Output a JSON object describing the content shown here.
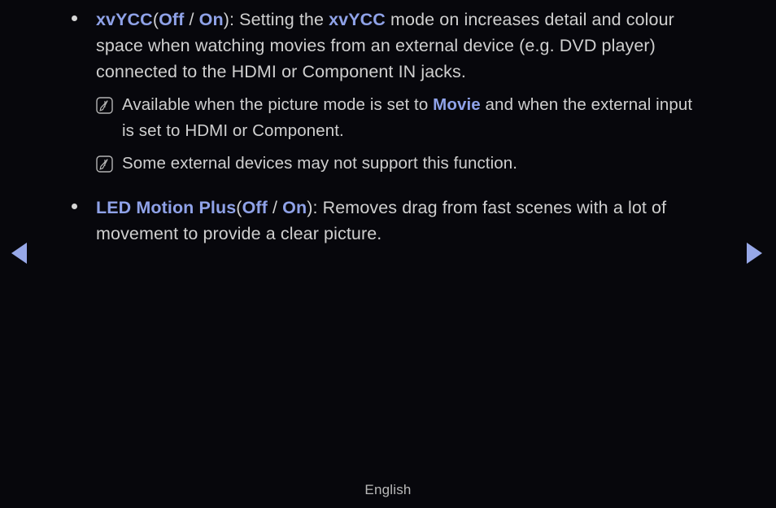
{
  "background_color": "#07070c",
  "accent_color": "#8fa2e8",
  "body_text_color": "#cfcfcf",
  "sections": [
    {
      "id": "xvycc",
      "bullet": "•",
      "title": "xvYCC",
      "options_open": "(",
      "option_off": "Off",
      "option_sep": " / ",
      "option_on": "On",
      "options_close": "): ",
      "body_part1": "Setting the ",
      "body_emphasis": "xvYCC",
      "body_part2": " mode on increases detail and colour space when watching movies from an external device (e.g. DVD player) connected to the HDMI or Component IN jacks.",
      "notes": [
        {
          "icon": "note-pencil-icon",
          "text_part1": "Available when the picture mode is set to ",
          "text_emphasis": "Movie",
          "text_part2": " and when the external input is set to HDMI or Component."
        },
        {
          "icon": "note-pencil-icon",
          "text_part1": "Some external devices may not support this function.",
          "text_emphasis": "",
          "text_part2": ""
        }
      ]
    },
    {
      "id": "led-motion-plus",
      "bullet": "•",
      "title": "LED Motion Plus",
      "options_open": "(",
      "option_off": "Off",
      "option_sep": " / ",
      "option_on": "On",
      "options_close": "): ",
      "body_part1": "Removes drag from fast scenes with a lot of movement to provide a clear picture.",
      "body_emphasis": "",
      "body_part2": "",
      "notes": []
    }
  ],
  "navigation": {
    "prev_label": "◀",
    "prev_name": "previous-page-arrow",
    "next_label": "▶",
    "next_name": "next-page-arrow"
  },
  "footer": {
    "language": "English"
  }
}
